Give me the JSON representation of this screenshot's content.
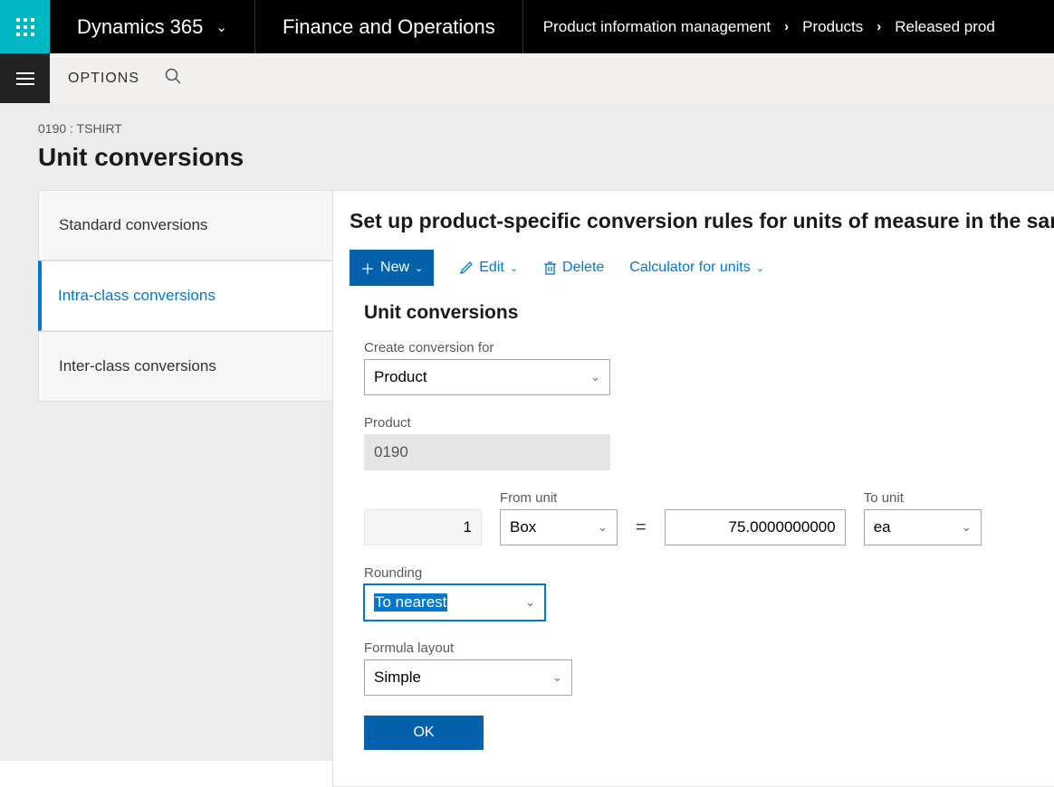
{
  "topnav": {
    "app_name": "Dynamics 365",
    "module": "Finance and Operations",
    "crumbs": [
      "Product information management",
      "Products",
      "Released prod"
    ]
  },
  "actionbar": {
    "options": "OPTIONS"
  },
  "page": {
    "context": "0190 : TSHIRT",
    "title": "Unit conversions"
  },
  "tabs": {
    "standard": "Standard conversions",
    "intra": "Intra-class conversions",
    "inter": "Inter-class conversions"
  },
  "panel": {
    "heading": "Set up product-specific conversion rules for units of measure in the sam",
    "toolbar": {
      "new_label": "New",
      "edit_label": "Edit",
      "delete_label": "Delete",
      "calc_label": "Calculator for units"
    },
    "form_title": "Unit conversions",
    "fields": {
      "create_for_label": "Create conversion for",
      "create_for_value": "Product",
      "product_label": "Product",
      "product_value": "0190",
      "qty_value": "1",
      "from_unit_label": "From unit",
      "from_unit_value": "Box",
      "factor_value": "75.0000000000",
      "to_unit_label": "To unit",
      "to_unit_value": "ea",
      "rounding_label": "Rounding",
      "rounding_value": "To nearest",
      "layout_label": "Formula layout",
      "layout_value": "Simple",
      "ok": "OK"
    }
  }
}
